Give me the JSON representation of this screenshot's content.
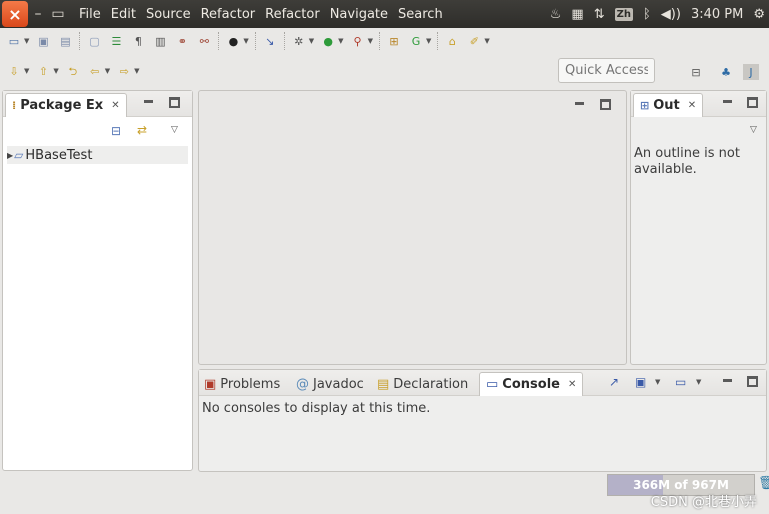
{
  "menubar": {
    "close_icon": "×",
    "menus": [
      "File",
      "Edit",
      "Source",
      "Refactor",
      "Refactor",
      "Navigate",
      "Search"
    ],
    "indicators": {
      "input_method": "Zh",
      "clock": "3:40 PM"
    }
  },
  "toolbar": {
    "quick_access_placeholder": "Quick Access"
  },
  "package_explorer": {
    "tab_label": "Package Ex",
    "project": "HBaseTest"
  },
  "outline": {
    "tab_label": "Out",
    "message": "An outline is not available."
  },
  "console_panel": {
    "tabs": [
      "Problems",
      "Javadoc",
      "Declaration",
      "Console"
    ],
    "active_tab": "Console",
    "message": "No consoles to display at this time."
  },
  "status": {
    "heap_label": "366M of 967M",
    "heap_used_fraction": 0.38,
    "watermark": "CSDN @北巷小弄"
  },
  "colors": {
    "close_button": "#e9541e",
    "menubar_bg": "#3c3b37",
    "window_bg": "#e9e8e6"
  }
}
